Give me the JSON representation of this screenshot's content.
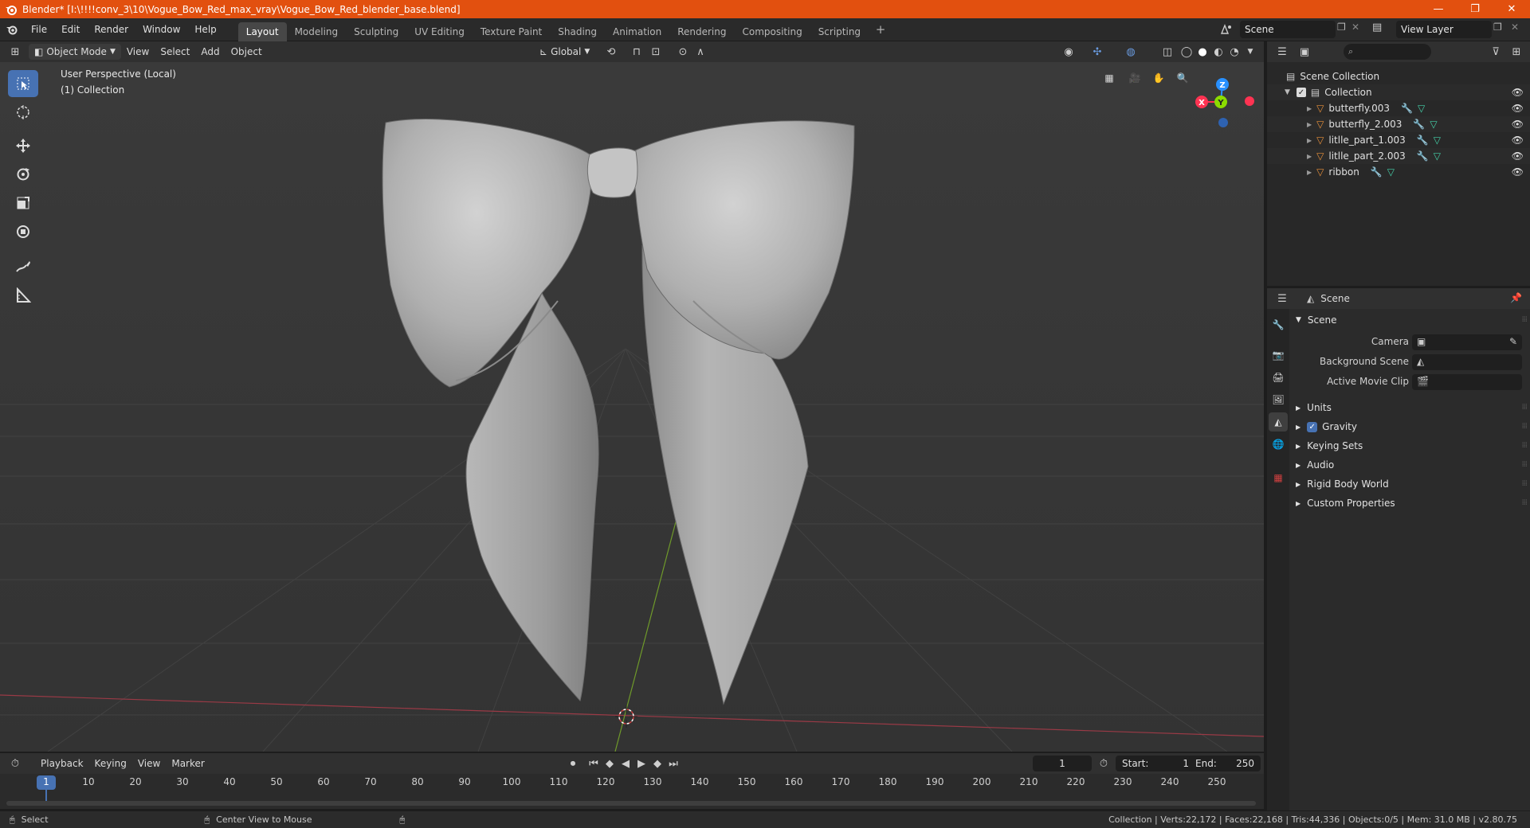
{
  "window": {
    "title": "Blender* [I:\\!!!!conv_3\\10\\Vogue_Bow_Red_max_vray\\Vogue_Bow_Red_blender_base.blend]",
    "controls": [
      "—",
      "❐",
      "✕"
    ]
  },
  "menu": [
    "File",
    "Edit",
    "Render",
    "Window",
    "Help"
  ],
  "workspaces": [
    "Layout",
    "Modeling",
    "Sculpting",
    "UV Editing",
    "Texture Paint",
    "Shading",
    "Animation",
    "Rendering",
    "Compositing",
    "Scripting"
  ],
  "active_workspace": "Layout",
  "scene_name": "Scene",
  "view_layer": "View Layer",
  "viewport_header": {
    "mode": "Object Mode",
    "menus": [
      "View",
      "Select",
      "Add",
      "Object"
    ],
    "orientation": "Global"
  },
  "viewport": {
    "perspective": "User Perspective (Local)",
    "collection": "(1) Collection",
    "gizmo_axes": {
      "x": "X",
      "y": "Y",
      "z": "Z"
    }
  },
  "outliner": {
    "root": "Scene Collection",
    "collection": "Collection",
    "objects": [
      "butterfly.003",
      "butterfly_2.003",
      "litlle_part_1.003",
      "litlle_part_2.003",
      "ribbon"
    ]
  },
  "properties": {
    "header": "Scene",
    "panel": "Scene",
    "fields": [
      {
        "label": "Camera"
      },
      {
        "label": "Background Scene"
      },
      {
        "label": "Active Movie Clip"
      }
    ],
    "sections": [
      "Units",
      "Gravity",
      "Keying Sets",
      "Audio",
      "Rigid Body World",
      "Custom Properties"
    ],
    "gravity_enabled": true
  },
  "timeline": {
    "menus": [
      "Playback",
      "Keying",
      "View",
      "Marker"
    ],
    "current_frame": "1",
    "start_label": "Start:",
    "start": "1",
    "end_label": "End:",
    "end": "250",
    "ruler": [
      "1",
      "10",
      "20",
      "30",
      "40",
      "50",
      "60",
      "70",
      "80",
      "90",
      "100",
      "110",
      "120",
      "130",
      "140",
      "150",
      "160",
      "170",
      "180",
      "190",
      "200",
      "210",
      "220",
      "230",
      "240",
      "250"
    ]
  },
  "statusbar": {
    "left": "Select",
    "middle": "Center View to Mouse",
    "right": "Collection | Verts:22,172 | Faces:22,168 | Tris:44,336 | Objects:0/5 | Mem: 31.0 MB | v2.80.75"
  },
  "colors": {
    "titlebar": "#e2500f",
    "accent": "#4772b3",
    "object_icon": "#e8903a",
    "x_axis": "#ff3352",
    "y_axis": "#8bdc00",
    "z_axis": "#2890ff"
  }
}
